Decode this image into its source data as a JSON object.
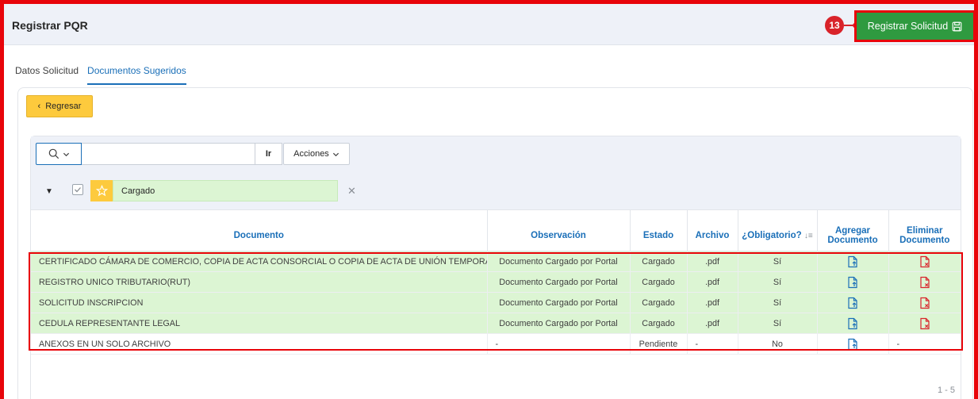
{
  "header": {
    "title": "Registrar PQR"
  },
  "step_marker": {
    "number": "13"
  },
  "register_button": {
    "label": "Registrar Solicitud"
  },
  "tabs": [
    {
      "label": "Datos Solicitud",
      "active": false
    },
    {
      "label": "Documentos Sugeridos",
      "active": true
    }
  ],
  "back_button": {
    "label": "Regresar"
  },
  "search": {
    "value": "",
    "placeholder": "",
    "go_label": "Ir"
  },
  "actions_menu": {
    "label": "Acciones"
  },
  "filter": {
    "label": "Cargado",
    "checked": true
  },
  "table": {
    "headers": {
      "documento": "Documento",
      "observacion": "Observación",
      "estado": "Estado",
      "archivo": "Archivo",
      "obligatorio": "¿Obligatorio?",
      "agregar": "Agregar Documento",
      "eliminar": "Eliminar Documento"
    },
    "rows": [
      {
        "documento": "CERTIFICADO CÁMARA DE COMERCIO, COPIA DE ACTA CONSORCIAL O COPIA DE ACTA DE UNIÓN TEMPORAL",
        "observacion": "Documento Cargado por Portal",
        "estado": "Cargado",
        "archivo": ".pdf",
        "obligatorio": "Sí",
        "eliminar": ""
      },
      {
        "documento": "REGISTRO UNICO TRIBUTARIO(RUT)",
        "observacion": "Documento Cargado por Portal",
        "estado": "Cargado",
        "archivo": ".pdf",
        "obligatorio": "Sí",
        "eliminar": ""
      },
      {
        "documento": "SOLICITUD INSCRIPCION",
        "observacion": "Documento Cargado por Portal",
        "estado": "Cargado",
        "archivo": ".pdf",
        "obligatorio": "Sí",
        "eliminar": ""
      },
      {
        "documento": "CEDULA REPRESENTANTE LEGAL",
        "observacion": "Documento Cargado por Portal",
        "estado": "Cargado",
        "archivo": ".pdf",
        "obligatorio": "Sí",
        "eliminar": ""
      },
      {
        "documento": "ANEXOS EN UN SOLO ARCHIVO",
        "observacion": "-",
        "estado": "Pendiente",
        "archivo": "-",
        "obligatorio": "No",
        "eliminar": "-"
      }
    ]
  },
  "pagination": {
    "label": "1 - 5"
  },
  "colors": {
    "accent": "#1a6fb8",
    "primary_button": "#2f9a40",
    "warning_button": "#fdca3d",
    "highlight_row": "#dcf5d3",
    "annotation_red": "#e8040a",
    "upload_icon": "#1a6fb8",
    "delete_icon": "#d9232a"
  },
  "icons": {
    "save": "floppy-disk-icon",
    "back": "chevron-left-icon",
    "search": "magnifier-icon",
    "upload": "file-upload-icon",
    "delete": "file-delete-icon",
    "star": "star-icon"
  }
}
